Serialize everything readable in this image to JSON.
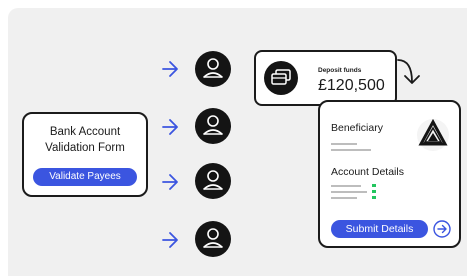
{
  "form_card": {
    "title_line1": "Bank Account",
    "title_line2": "Validation Form",
    "validate_button": "Validate Payees"
  },
  "deposit_card": {
    "label": "Deposit funds",
    "amount": "£120,500"
  },
  "details_card": {
    "beneficiary_label": "Beneficiary",
    "account_details_label": "Account Details",
    "submit_button": "Submit Details"
  },
  "colors": {
    "accent_blue": "#3b55e0",
    "dark": "#141414",
    "green": "#22c55e"
  }
}
